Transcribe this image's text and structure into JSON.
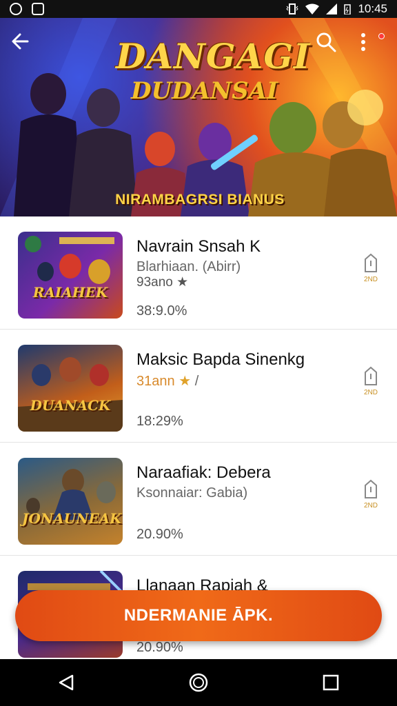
{
  "status_bar": {
    "time": "10:45",
    "icons": [
      "app-icon",
      "gallery-icon",
      "vibrate-icon",
      "wifi-icon",
      "signal-icon",
      "battery-icon"
    ]
  },
  "hero": {
    "title": "DANGAGI",
    "title_line2": "DUDANSAI",
    "subtitle": "NIRAMBAGRSI BIANUS",
    "back_icon": "back-arrow-icon",
    "search_icon": "search-icon",
    "menu_icon": "more-vert-icon"
  },
  "apps": [
    {
      "title": "Navrain Snsah K",
      "meta": "Blarhiaan. (Abirr)",
      "rating_text": "93ano",
      "pct": "38:9.0%",
      "thumb_label": "RAIAHEK",
      "dl_label": "2ND",
      "colors": [
        "#3a2f8c",
        "#7a2aa8",
        "#c94a1c"
      ]
    },
    {
      "title": "Maksic Bapda Sinenkg",
      "meta": "31ann",
      "rating_text": "",
      "pct": "18:29%",
      "thumb_label": "DUANACK",
      "dl_label": "2ND",
      "colors": [
        "#1f3a6e",
        "#c25e1a",
        "#e2a030"
      ]
    },
    {
      "title": "Naraafiak: Debera",
      "meta": "Ksonnaiar: Gabia)",
      "rating_text": "",
      "pct": "20.90%",
      "thumb_label": "JONAUNEAK",
      "dl_label": "2ND",
      "colors": [
        "#2b5a86",
        "#8a6a38",
        "#c4822c"
      ]
    },
    {
      "title": "Llanaan Rapiah &",
      "meta": "",
      "rating_text": "",
      "pct": "20.90%",
      "thumb_label": "",
      "dl_label": "",
      "colors": [
        "#1e2a6a",
        "#4a2a8c",
        "#9a3a2a"
      ]
    }
  ],
  "install_button": {
    "label": "NDERMANIE ĀPK."
  },
  "nav": {
    "back": "nav-back-icon",
    "home": "nav-home-icon",
    "recents": "nav-recents-icon"
  },
  "colors": {
    "accent": "#e8551a",
    "rating_orange": "#d88a2c",
    "status_bar": "#111111"
  }
}
